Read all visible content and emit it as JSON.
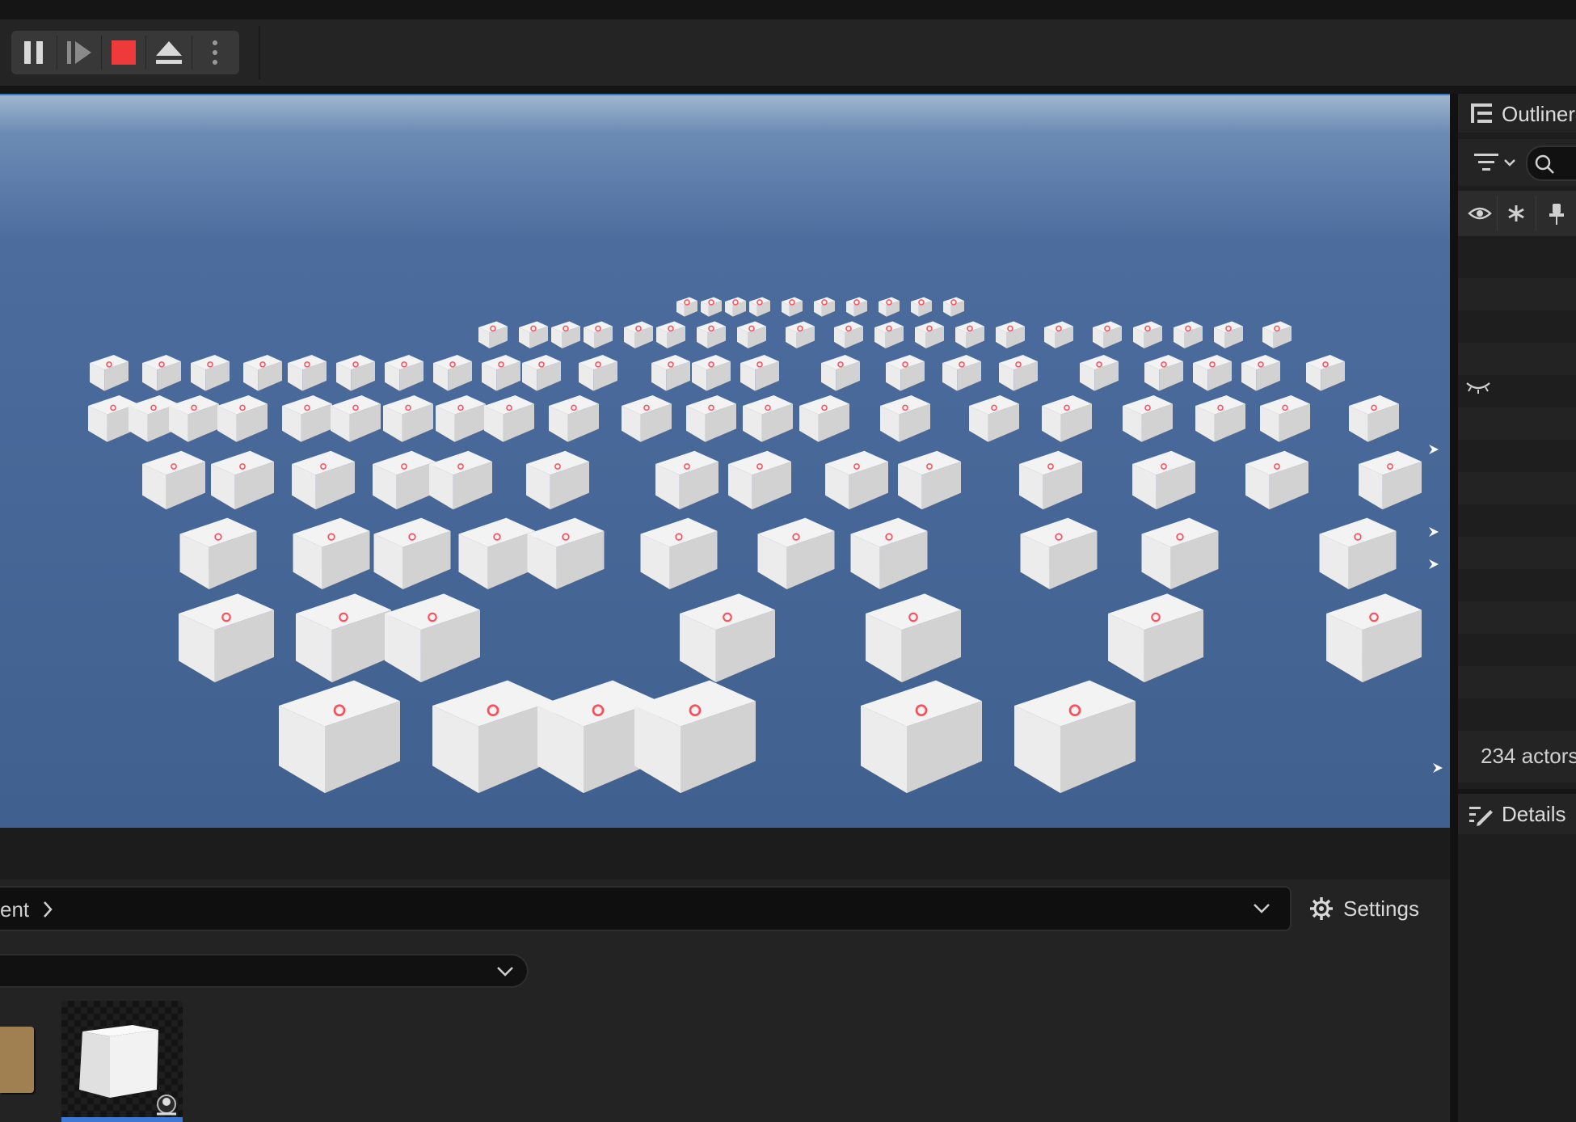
{
  "toolbar": {
    "buttons": [
      {
        "name": "pause",
        "icon": "pause-icon"
      },
      {
        "name": "advance-frame",
        "icon": "frame-advance-icon"
      },
      {
        "name": "stop",
        "icon": "stop-icon",
        "color": "#e53935"
      },
      {
        "name": "eject",
        "icon": "eject-icon"
      },
      {
        "name": "more",
        "icon": "more-vertical-icon"
      }
    ]
  },
  "viewport": {
    "sky_color": "#4a6a9c",
    "cube_color": "#ececec",
    "marker_color": "#ff4d5a"
  },
  "outliner": {
    "title": "Outliner",
    "columns": [
      "visibility-icon",
      "asterisk-icon",
      "pin-icon"
    ],
    "actor_count": "234 actors"
  },
  "details": {
    "title": "Details"
  },
  "content_browser": {
    "path_text": "ent",
    "settings_label": "Settings",
    "filter_value": "",
    "asset_selected": "cube"
  },
  "colors": {
    "accent": "#3c78d8",
    "panel": "#242424",
    "background": "#151515"
  }
}
